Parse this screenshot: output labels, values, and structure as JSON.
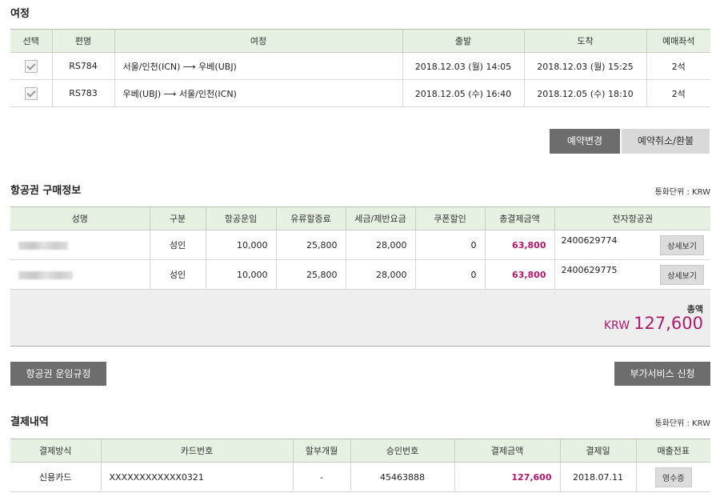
{
  "itinerary": {
    "title": "여정",
    "headers": [
      "선택",
      "편명",
      "여정",
      "출발",
      "도착",
      "예매좌석"
    ],
    "rows": [
      {
        "flight": "RS784",
        "route": "서울/인천(ICN)  ⟶  우베(UBJ)",
        "depart": "2018.12.03 (월) 14:05",
        "arrive": "2018.12.03 (월) 15:25",
        "seats": "2석"
      },
      {
        "flight": "RS783",
        "route": "우베(UBJ)  ⟶  서울/인천(ICN)",
        "depart": "2018.12.05 (수) 16:40",
        "arrive": "2018.12.05 (수) 18:10",
        "seats": "2석"
      }
    ],
    "change_label": "예약변경",
    "cancel_label": "예약취소/환불"
  },
  "purchase": {
    "title": "항공권 구매정보",
    "currency_unit": "통화단위 : KRW",
    "headers": [
      "성명",
      "구분",
      "항공운임",
      "유류할증료",
      "세금/제반요금",
      "쿠폰할인",
      "총결제금액",
      "전자항공권"
    ],
    "rows": [
      {
        "type": "성인",
        "fare": "10,000",
        "fuel": "25,800",
        "tax": "28,000",
        "coupon": "0",
        "total": "63,800",
        "ticket": "2400629774",
        "detail_label": "상세보기"
      },
      {
        "type": "성인",
        "fare": "10,000",
        "fuel": "25,800",
        "tax": "28,000",
        "coupon": "0",
        "total": "63,800",
        "ticket": "2400629775",
        "detail_label": "상세보기"
      }
    ],
    "total_label": "총액",
    "total_currency": "KRW",
    "total_amount": "127,600",
    "fare_rules_label": "항공권 운임규정",
    "extra_service_label": "부가서비스 신청"
  },
  "payment": {
    "title": "결제내역",
    "currency_unit": "통화단위 : KRW",
    "headers": [
      "결제방식",
      "카드번호",
      "할부개월",
      "승인번호",
      "결제금액",
      "결제일",
      "매출전표"
    ],
    "row": {
      "method": "신용카드",
      "card": "XXXXXXXXXXXX0321",
      "installment": "-",
      "approval": "45463888",
      "amount": "127,600",
      "date": "2018.07.11",
      "receipt_label": "영수증"
    }
  },
  "colors": {
    "header_bg": "#e6f1e2",
    "accent_pink": "#b0176a",
    "button_dark": "#6d6d6d"
  }
}
